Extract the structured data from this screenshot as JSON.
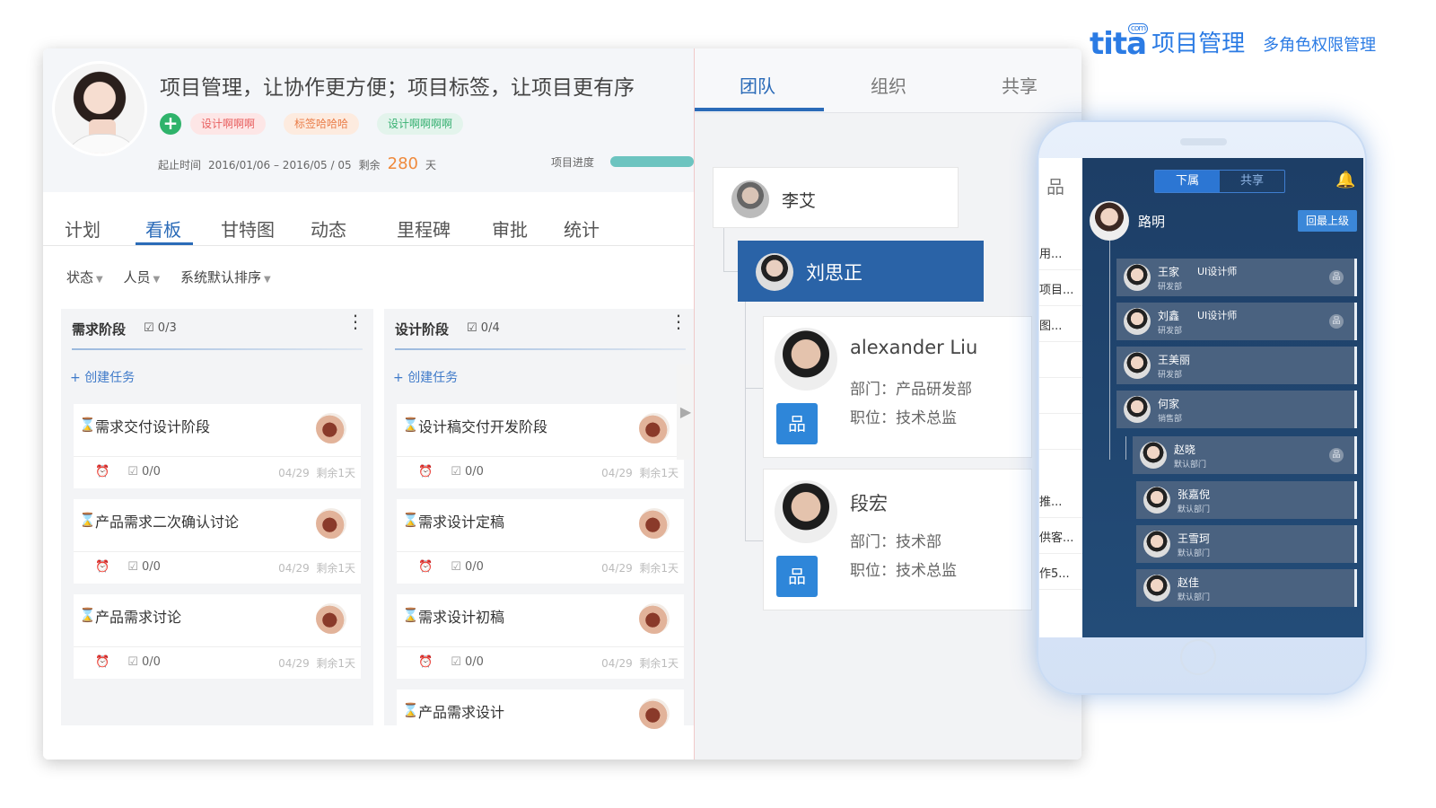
{
  "brand": {
    "logo": "tita",
    "com": "com",
    "product": "项目管理",
    "tagline": "多角色权限管理",
    "color": "#2b7be4"
  },
  "project": {
    "title": "项目管理，让协作更方便；项目标签，让项目更有序",
    "add_icon": "plus-circle-icon",
    "tags": [
      "设计啊啊啊",
      "标签哈哈哈",
      "设计啊啊啊啊"
    ],
    "date_label": "起止时间",
    "date_range": "2016/01/06 – 2016/05 / 05",
    "remaining_label": "剩余",
    "remaining_days": "280",
    "remaining_unit": "天",
    "progress_label": "项目进度"
  },
  "tabs": [
    "计划",
    "看板",
    "甘特图",
    "动态",
    "里程碑",
    "审批",
    "统计"
  ],
  "active_tab": "看板",
  "filters": [
    "状态",
    "人员",
    "系统默认排序"
  ],
  "columns": [
    {
      "name": "需求阶段",
      "count": "0/3",
      "create_label": "创建任务",
      "cards": [
        {
          "title": "需求交付设计阶段",
          "subtasks": "0/0",
          "date": "04/29",
          "remain": "剩余1天"
        },
        {
          "title": "产品需求二次确认讨论",
          "subtasks": "0/0",
          "date": "04/29",
          "remain": "剩余1天"
        },
        {
          "title": "产品需求讨论",
          "subtasks": "0/0",
          "date": "04/29",
          "remain": "剩余1天"
        }
      ]
    },
    {
      "name": "设计阶段",
      "count": "0/4",
      "create_label": "创建任务",
      "cards": [
        {
          "title": "设计稿交付开发阶段",
          "subtasks": "0/0",
          "date": "04/29",
          "remain": "剩余1天"
        },
        {
          "title": "需求设计定稿",
          "subtasks": "0/0",
          "date": "04/29",
          "remain": "剩余1天"
        },
        {
          "title": "需求设计初稿",
          "subtasks": "0/0",
          "date": "04/29",
          "remain": "剩余1天"
        },
        {
          "title": "产品需求设计"
        }
      ]
    }
  ],
  "team_panel": {
    "tabs": [
      "团队",
      "组织",
      "共享"
    ],
    "active_tab": "团队",
    "nodes": [
      {
        "name": "李艾"
      },
      {
        "name": "刘思正"
      }
    ],
    "people": [
      {
        "name": "alexander Liu",
        "dept": "部门：产品研发部",
        "position": "职位：技术总监"
      },
      {
        "name": "段宏",
        "dept": "部门：技术部",
        "position": "职位：技术总监"
      }
    ]
  },
  "mobile": {
    "side_snippets": [
      "用...",
      "项目...",
      "图...",
      "推...",
      "供客...",
      "作5..."
    ],
    "segments": [
      "下属",
      "共享"
    ],
    "active_segment": "下属",
    "me": "路明",
    "back_button": "回最上级",
    "members": [
      {
        "name": "王家",
        "dept": "研发部",
        "role": "UI设计师"
      },
      {
        "name": "刘鑫",
        "dept": "研发部",
        "role": "UI设计师"
      },
      {
        "name": "王美丽",
        "dept": "研发部",
        "role": ""
      },
      {
        "name": "何家",
        "dept": "销售部",
        "role": ""
      },
      {
        "name": "赵晓",
        "dept": "默认部门",
        "role": ""
      },
      {
        "name": "张嘉倪",
        "dept": "默认部门",
        "role": ""
      },
      {
        "name": "王雪珂",
        "dept": "默认部门",
        "role": ""
      },
      {
        "name": "赵佳",
        "dept": "默认部门",
        "role": ""
      }
    ]
  }
}
